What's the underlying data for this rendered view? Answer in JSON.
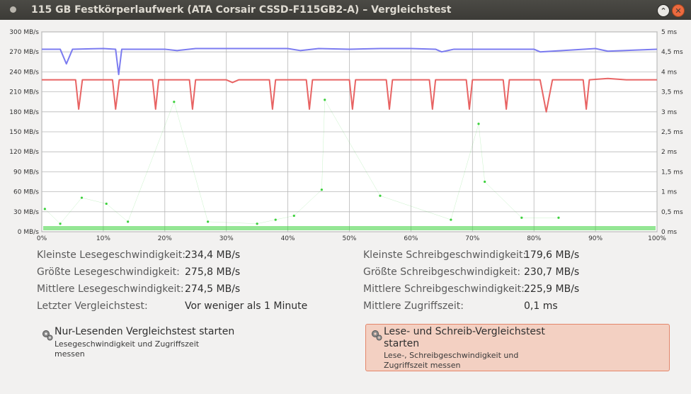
{
  "window": {
    "title": "115 GB Festkörperlaufwerk (ATA Corsair CSSD-F115GB2-A) – Vergleichstest"
  },
  "chart_data": {
    "type": "line",
    "x_ticks": [
      "0%",
      "10%",
      "20%",
      "30%",
      "40%",
      "50%",
      "60%",
      "70%",
      "80%",
      "90%",
      "100%"
    ],
    "y_left_ticks": [
      "0 MB/s",
      "30 MB/s",
      "60 MB/s",
      "90 MB/s",
      "120 MB/s",
      "150 MB/s",
      "180 MB/s",
      "210 MB/s",
      "240 MB/s",
      "270 MB/s",
      "300 MB/s"
    ],
    "y_right_ticks": [
      "0 ms",
      "0,5 ms",
      "1 ms",
      "1,5 ms",
      "2 ms",
      "2,5 ms",
      "3 ms",
      "3,5 ms",
      "4 ms",
      "4,5 ms",
      "5 ms"
    ],
    "xlim": [
      0,
      100
    ],
    "ylim_left": [
      0,
      300
    ],
    "ylim_right": [
      0,
      5
    ],
    "grid": true,
    "colors": {
      "read": "#7b7bf0",
      "write": "#e86464",
      "access": "#3cd13c"
    },
    "series": [
      {
        "key": "read",
        "x": [
          0,
          3,
          4,
          5,
          10,
          12,
          12.5,
          13,
          20,
          22,
          25,
          30,
          40,
          42,
          45,
          50,
          55,
          60,
          64,
          65,
          67,
          70,
          80,
          81,
          90,
          92,
          100
        ],
        "y": [
          274,
          274,
          252,
          274,
          275,
          274,
          236,
          274,
          274,
          272,
          275,
          275,
          275,
          272,
          275,
          274,
          275,
          275,
          274,
          270,
          274,
          274,
          274,
          270,
          275,
          271,
          274
        ]
      },
      {
        "key": "write",
        "x": [
          0,
          5.5,
          6,
          6.6,
          11.5,
          12,
          12.6,
          18,
          18.5,
          19,
          24,
          24.5,
          25,
          30,
          31,
          32,
          37,
          37.5,
          38,
          43,
          43.5,
          44,
          50,
          50.5,
          51,
          56,
          56.5,
          57,
          63,
          63.5,
          64,
          69,
          69.5,
          70,
          75,
          75.5,
          76,
          81,
          82,
          83,
          88,
          88.5,
          89,
          92,
          95,
          100
        ],
        "y": [
          228,
          228,
          184,
          228,
          228,
          184,
          228,
          228,
          184,
          228,
          228,
          184,
          228,
          228,
          224,
          228,
          228,
          184,
          228,
          228,
          184,
          228,
          228,
          184,
          228,
          228,
          184,
          228,
          228,
          184,
          228,
          228,
          184,
          228,
          228,
          184,
          228,
          228,
          180,
          228,
          228,
          184,
          228,
          230,
          228,
          228
        ]
      },
      {
        "key": "access",
        "x": [
          0.5,
          3,
          6.5,
          10.5,
          14,
          21.5,
          27,
          35,
          38,
          41,
          45.5,
          46,
          55,
          66.5,
          71,
          72,
          78,
          84
        ],
        "y": [
          0.57,
          0.2,
          0.85,
          0.7,
          0.25,
          3.25,
          0.25,
          0.2,
          0.3,
          0.4,
          1.05,
          3.3,
          0.9,
          0.3,
          2.7,
          1.25,
          0.35,
          0.35
        ]
      }
    ]
  },
  "stats": {
    "left": [
      {
        "label": "Kleinste Lesegeschwindigkeit:",
        "value": "234,4 MB/s"
      },
      {
        "label": "Größte Lesegeschwindigkeit:",
        "value": "275,8 MB/s"
      },
      {
        "label": "Mittlere Lesegeschwindigkeit:",
        "value": "274,5 MB/s"
      },
      {
        "label": "Letzter Vergleichstest:",
        "value": "Vor weniger als 1 Minute"
      }
    ],
    "right": [
      {
        "label": "Kleinste Schreibgeschwindigkeit:",
        "value": "179,6 MB/s"
      },
      {
        "label": "Größte Schreibgeschwindigkeit:",
        "value": "230,7 MB/s"
      },
      {
        "label": "Mittlere Schreibgeschwindigkeit:",
        "value": "225,9 MB/s"
      },
      {
        "label": "Mittlere Zugriffszeit:",
        "value": "0,1 ms"
      }
    ]
  },
  "actions": {
    "read_only": {
      "title": "Nur-Lesenden Vergleichstest starten",
      "desc_line1": "Lesegeschwindigkeit und Zugriffszeit",
      "desc_line2": "messen"
    },
    "read_write": {
      "title_line1": "Lese- und Schreib-Vergleichstest",
      "title_line2": "starten",
      "desc_line1": "Lese-, Schreibgeschwindigkeit und",
      "desc_line2": "Zugriffszeit messen"
    }
  }
}
